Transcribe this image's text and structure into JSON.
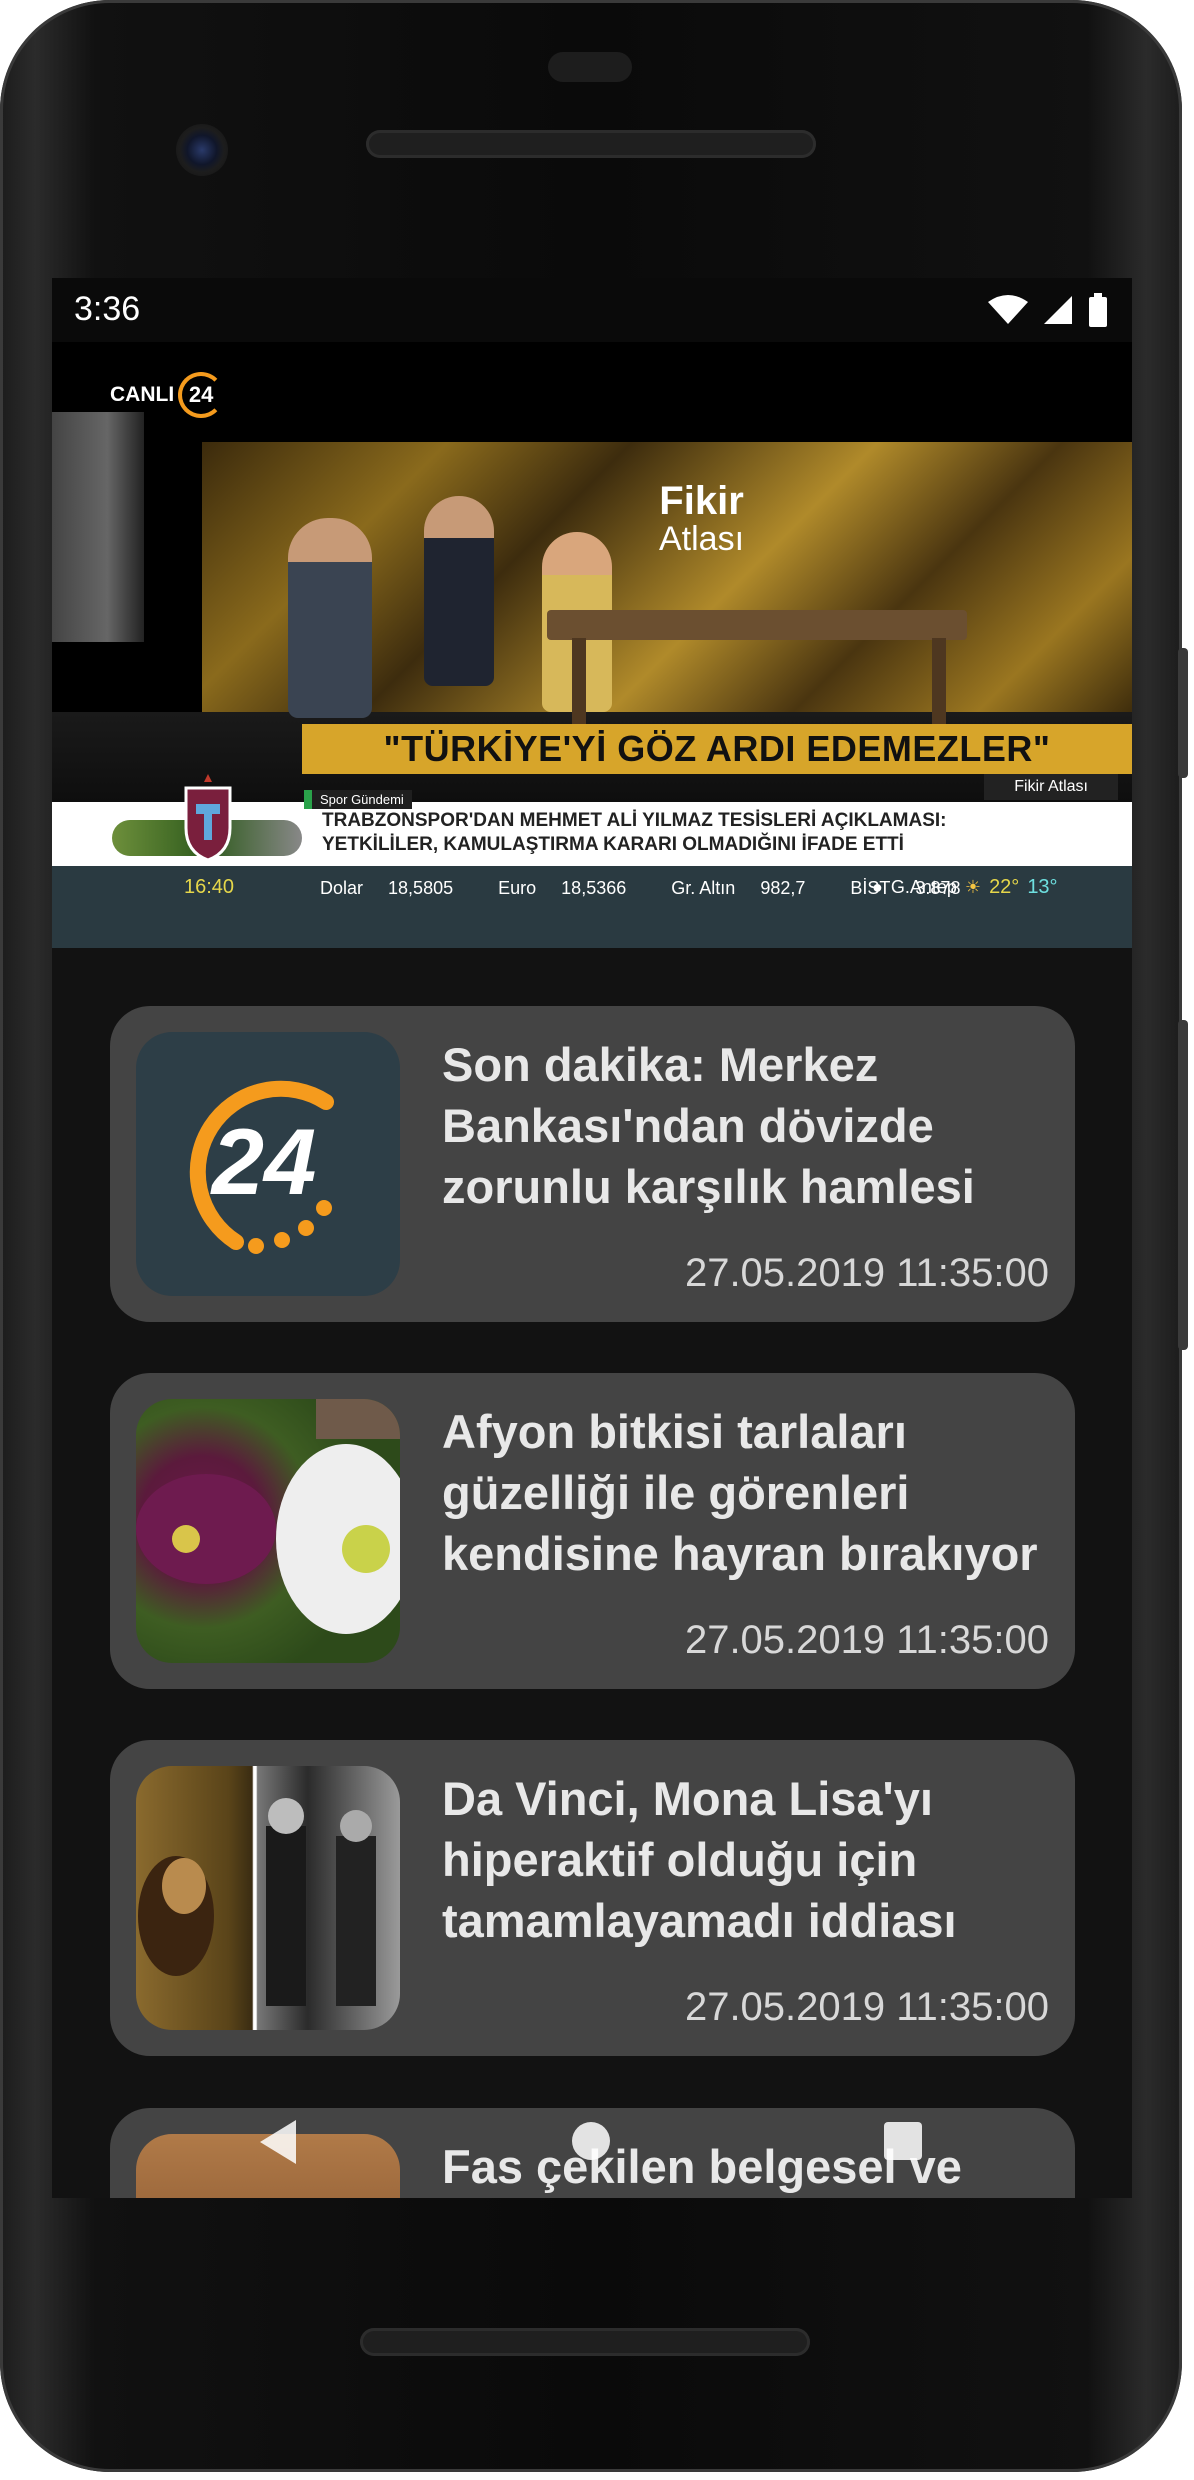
{
  "status_bar": {
    "time": "3:36"
  },
  "video": {
    "channel_live": "CANLI",
    "channel_logo": "24",
    "program_title": "Fikir",
    "program_title_sub": "Atlası",
    "headline": "\"TÜRKİYE'Yİ GÖZ ARDI EDEMEZLER\"",
    "program_tag": "Fikir Atlası",
    "ticker_label": "Spor Gündemi",
    "ticker_line1": "TRABZONSPOR'DAN MEHMET ALİ YILMAZ TESİSLERİ AÇIKLAMASI:",
    "ticker_line2": "YETKİLİLER, KAMULAŞTIRMA KARARI OLMADIĞINI İFADE ETTİ",
    "info_time": "16:40",
    "markets": [
      {
        "label": "Dolar",
        "value": "18,5805"
      },
      {
        "label": "Euro",
        "value": "18,5366"
      },
      {
        "label": "Gr. Altın",
        "value": "982,7"
      },
      {
        "label": "BİST",
        "value": "3.878"
      }
    ],
    "weather_city": "G.Antep",
    "temp_high": "22°",
    "temp_low": "13°"
  },
  "news": [
    {
      "title": "Son dakika: Merkez Bankası'ndan dövizde zorunlu karşılık hamlesi",
      "date": "27.05.2019 11:35:00",
      "thumb": "24-logo"
    },
    {
      "title": "Afyon bitkisi tarlaları güzelliği ile görenleri kendisine hayran bırakıyor",
      "date": "27.05.2019 11:35:00",
      "thumb": "poppy-flowers"
    },
    {
      "title": "Da Vinci, Mona Lisa'yı hiperaktif olduğu için tamamlayamadı iddiası",
      "date": "27.05.2019 11:35:00",
      "thumb": "mona-lisa-collage"
    },
    {
      "title": "Fas çekilen belgesel ve",
      "date": "",
      "thumb": "morocco-city"
    }
  ],
  "colors": {
    "accent": "#f59b1d",
    "card_bg": "#444444",
    "screen_bg": "#121212"
  }
}
